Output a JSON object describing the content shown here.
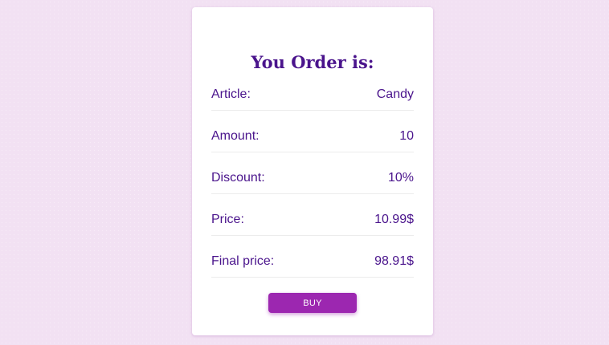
{
  "order": {
    "title": "You Order is:",
    "rows": [
      {
        "label": "Article:",
        "value": "Candy"
      },
      {
        "label": "Amount:",
        "value": "10"
      },
      {
        "label": "Discount:",
        "value": "10%"
      },
      {
        "label": "Price:",
        "value": "10.99$"
      },
      {
        "label": "Final price:",
        "value": "98.91$"
      }
    ],
    "buy_label": "BUY"
  },
  "colors": {
    "background": "#f2e1f3",
    "text": "#4a148c",
    "button": "#9c27b0"
  }
}
